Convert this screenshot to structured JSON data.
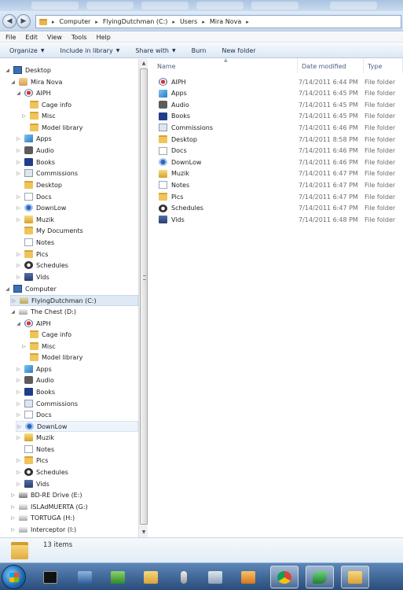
{
  "address": {
    "crumbs": [
      "Computer",
      "FlyingDutchman (C:)",
      "Users",
      "Mira Nova"
    ]
  },
  "menu": [
    "File",
    "Edit",
    "View",
    "Tools",
    "Help"
  ],
  "commands": [
    {
      "label": "Organize",
      "dropdown": true
    },
    {
      "label": "Include in library",
      "dropdown": true
    },
    {
      "label": "Share with",
      "dropdown": true
    },
    {
      "label": "Burn",
      "dropdown": false
    },
    {
      "label": "New folder",
      "dropdown": false
    }
  ],
  "tree": [
    {
      "label": "Desktop",
      "icon": "desktop-icon"
    },
    {
      "label": "Mira Nova",
      "icon": "user-folder-icon"
    },
    {
      "label": "AIPH",
      "icon": "aiph-icon"
    },
    {
      "label": "Cage info",
      "icon": "folder-icon"
    },
    {
      "label": "Misc",
      "icon": "folder-icon"
    },
    {
      "label": "Model library",
      "icon": "folder-icon"
    },
    {
      "label": "Apps",
      "icon": "apps-icon"
    },
    {
      "label": "Audio",
      "icon": "audio-icon"
    },
    {
      "label": "Books",
      "icon": "books-icon"
    },
    {
      "label": "Commissions",
      "icon": "commissions-icon"
    },
    {
      "label": "Desktop",
      "icon": "folder-icon"
    },
    {
      "label": "Docs",
      "icon": "docs-icon"
    },
    {
      "label": "DownLow",
      "icon": "downlow-icon"
    },
    {
      "label": "Muzik",
      "icon": "muzik-icon"
    },
    {
      "label": "My Documents",
      "icon": "folder-icon"
    },
    {
      "label": "Notes",
      "icon": "docs-icon"
    },
    {
      "label": "Pics",
      "icon": "folder-icon"
    },
    {
      "label": "Schedules",
      "icon": "clock-icon"
    },
    {
      "label": "Vids",
      "icon": "vids-icon"
    },
    {
      "label": "Computer",
      "icon": "computer-icon"
    },
    {
      "label": "FlyingDutchman (C:)",
      "icon": "drive-c-icon"
    },
    {
      "label": "The Chest (D:)",
      "icon": "drive-icon"
    },
    {
      "label": "AIPH",
      "icon": "aiph-icon"
    },
    {
      "label": "Cage info",
      "icon": "folder-icon"
    },
    {
      "label": "Misc",
      "icon": "folder-icon"
    },
    {
      "label": "Model library",
      "icon": "folder-icon"
    },
    {
      "label": "Apps",
      "icon": "apps-icon"
    },
    {
      "label": "Audio",
      "icon": "audio-icon"
    },
    {
      "label": "Books",
      "icon": "books-icon"
    },
    {
      "label": "Commissions",
      "icon": "commissions-icon"
    },
    {
      "label": "Docs",
      "icon": "docs-icon"
    },
    {
      "label": "DownLow",
      "icon": "downlow-icon"
    },
    {
      "label": "Muzik",
      "icon": "muzik-icon"
    },
    {
      "label": "Notes",
      "icon": "docs-icon"
    },
    {
      "label": "Pics",
      "icon": "folder-icon"
    },
    {
      "label": "Schedules",
      "icon": "clock-icon"
    },
    {
      "label": "Vids",
      "icon": "vids-icon"
    },
    {
      "label": "BD-RE Drive (E:)",
      "icon": "bd-drive-icon"
    },
    {
      "label": "ISLAdMUERTA (G:)",
      "icon": "drive-icon"
    },
    {
      "label": "TORTUGA (H:)",
      "icon": "drive-icon"
    },
    {
      "label": "Interceptor (I:)",
      "icon": "drive-icon"
    }
  ],
  "columns": {
    "name": "Name",
    "date": "Date modified",
    "type": "Type"
  },
  "files": [
    {
      "name": "AIPH",
      "date": "7/14/2011 6:44 PM",
      "type": "File folder",
      "icon": "aiph-icon"
    },
    {
      "name": "Apps",
      "date": "7/14/2011 6:45 PM",
      "type": "File folder",
      "icon": "apps-icon"
    },
    {
      "name": "Audio",
      "date": "7/14/2011 6:45 PM",
      "type": "File folder",
      "icon": "audio-icon"
    },
    {
      "name": "Books",
      "date": "7/14/2011 6:45 PM",
      "type": "File folder",
      "icon": "books-icon"
    },
    {
      "name": "Commissions",
      "date": "7/14/2011 6:46 PM",
      "type": "File folder",
      "icon": "commissions-icon"
    },
    {
      "name": "Desktop",
      "date": "7/14/2011 8:58 PM",
      "type": "File folder",
      "icon": "folder-icon"
    },
    {
      "name": "Docs",
      "date": "7/14/2011 6:46 PM",
      "type": "File folder",
      "icon": "docs-icon"
    },
    {
      "name": "DownLow",
      "date": "7/14/2011 6:46 PM",
      "type": "File folder",
      "icon": "downlow-icon"
    },
    {
      "name": "Muzik",
      "date": "7/14/2011 6:47 PM",
      "type": "File folder",
      "icon": "muzik-icon"
    },
    {
      "name": "Notes",
      "date": "7/14/2011 6:47 PM",
      "type": "File folder",
      "icon": "docs-icon"
    },
    {
      "name": "Pics",
      "date": "7/14/2011 6:47 PM",
      "type": "File folder",
      "icon": "folder-icon"
    },
    {
      "name": "Schedules",
      "date": "7/14/2011 6:47 PM",
      "type": "File folder",
      "icon": "clock-icon"
    },
    {
      "name": "Vids",
      "date": "7/14/2011 6:48 PM",
      "type": "File folder",
      "icon": "vids-icon"
    }
  ],
  "status": {
    "count": "13 items"
  },
  "taskbar": [
    {
      "icon": "start-orb-icon"
    },
    {
      "icon": "command-prompt-icon"
    },
    {
      "icon": "ship-app-icon"
    },
    {
      "icon": "green-app-icon"
    },
    {
      "icon": "explorer-folder-icon"
    },
    {
      "icon": "microphone-icon"
    },
    {
      "icon": "calculator-icon"
    },
    {
      "icon": "media-app-icon"
    },
    {
      "icon": "chrome-icon"
    },
    {
      "icon": "green-wave-icon"
    },
    {
      "icon": "explorer-active-icon"
    }
  ]
}
